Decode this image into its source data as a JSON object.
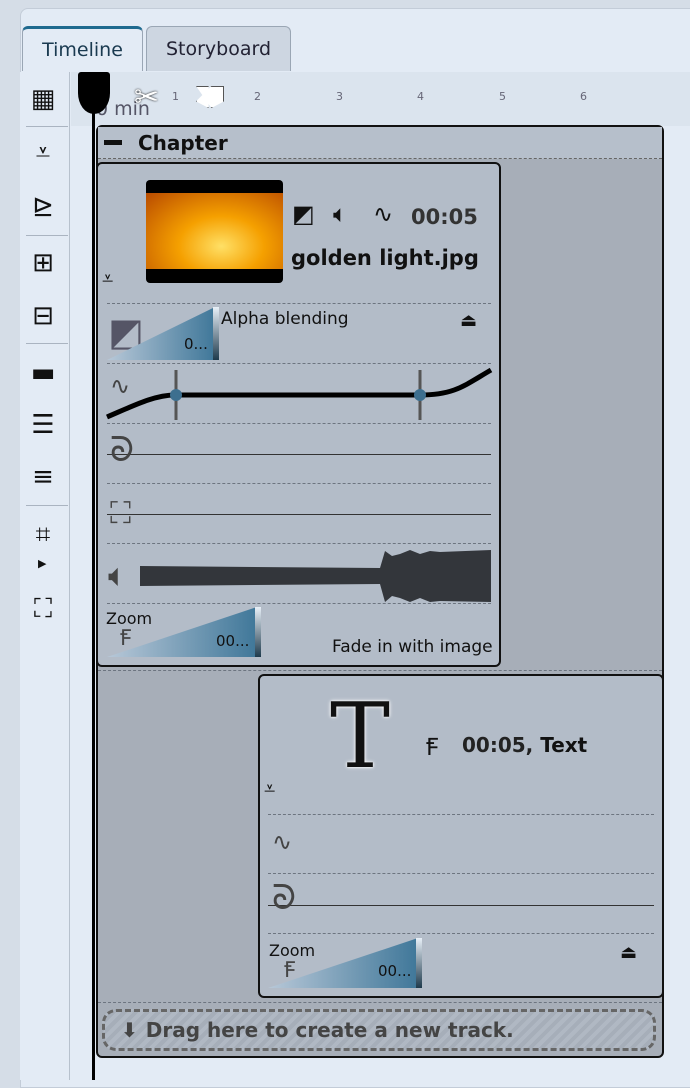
{
  "tabs": [
    {
      "label": "Timeline",
      "active": true
    },
    {
      "label": "Storyboard",
      "active": false
    }
  ],
  "toolbar": {
    "icons": [
      "storyboard-grid-icon",
      "collapse-icon",
      "expand-icon",
      "add-track-icon",
      "remove-track-icon",
      "film-strip-icon",
      "align-left-icon",
      "align-stagger-icon",
      "crop-icon",
      "fit-icon"
    ]
  },
  "ruler": {
    "start_label": "0 min",
    "ticks": [
      "1",
      "2",
      "3",
      "4",
      "5",
      "6"
    ]
  },
  "chapter": {
    "title": "Chapter",
    "collapse_symbol": "−"
  },
  "clip1": {
    "duration": "00:05",
    "filename": "golden light.jpg",
    "blend_label": "Alpha blending",
    "blend_value": "0...",
    "effect_label": "Zoom",
    "effect_value": "00...",
    "sound_label": "Fade in with image"
  },
  "clip2": {
    "letter": "T",
    "title": "00:05,",
    "type": "Text",
    "effect_label": "Zoom",
    "effect_value": "00..."
  },
  "dropzone": {
    "label": "Drag here to create a new track."
  },
  "colors": {
    "accent": "#1f6a8f",
    "ramp": "#3f7799"
  }
}
